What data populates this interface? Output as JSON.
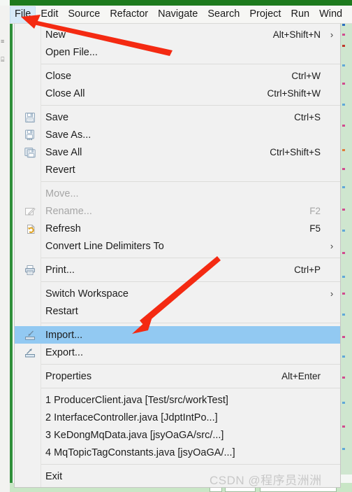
{
  "colors": {
    "accent_highlight": "#92c9f2",
    "menubar_active": "#d7e9f7",
    "menu_background": "#f1f1f1",
    "annotation_red": "#f42a12",
    "ide_green": "#2f8f3a",
    "watermark_gray": "#c8c8c8"
  },
  "menubar": {
    "items": [
      {
        "label": "File",
        "active": true
      },
      {
        "label": "Edit",
        "active": false
      },
      {
        "label": "Source",
        "active": false
      },
      {
        "label": "Refactor",
        "active": false
      },
      {
        "label": "Navigate",
        "active": false
      },
      {
        "label": "Search",
        "active": false
      },
      {
        "label": "Project",
        "active": false
      },
      {
        "label": "Run",
        "active": false
      },
      {
        "label": "Wind",
        "active": false
      }
    ]
  },
  "file_menu": {
    "groups": [
      {
        "items": [
          {
            "label": "New",
            "shortcut": "Alt+Shift+N",
            "submenu": true,
            "icon": "",
            "disabled": false,
            "highlight": false
          },
          {
            "label": "Open File...",
            "shortcut": "",
            "submenu": false,
            "icon": "",
            "disabled": false,
            "highlight": false
          }
        ]
      },
      {
        "items": [
          {
            "label": "Close",
            "shortcut": "Ctrl+W",
            "submenu": false,
            "icon": "",
            "disabled": false,
            "highlight": false
          },
          {
            "label": "Close All",
            "shortcut": "Ctrl+Shift+W",
            "submenu": false,
            "icon": "",
            "disabled": false,
            "highlight": false
          }
        ]
      },
      {
        "items": [
          {
            "label": "Save",
            "shortcut": "Ctrl+S",
            "submenu": false,
            "icon": "save-floppy-icon",
            "disabled": false,
            "highlight": false
          },
          {
            "label": "Save As...",
            "shortcut": "",
            "submenu": false,
            "icon": "save-as-floppy-icon",
            "disabled": false,
            "highlight": false
          },
          {
            "label": "Save All",
            "shortcut": "Ctrl+Shift+S",
            "submenu": false,
            "icon": "save-all-floppy-icon",
            "disabled": false,
            "highlight": false
          },
          {
            "label": "Revert",
            "shortcut": "",
            "submenu": false,
            "icon": "",
            "disabled": false,
            "highlight": false
          }
        ]
      },
      {
        "items": [
          {
            "label": "Move...",
            "shortcut": "",
            "submenu": false,
            "icon": "",
            "disabled": true,
            "highlight": false
          },
          {
            "label": "Rename...",
            "shortcut": "F2",
            "submenu": false,
            "icon": "rename-pencil-icon",
            "disabled": true,
            "highlight": false
          },
          {
            "label": "Refresh",
            "shortcut": "F5",
            "submenu": false,
            "icon": "refresh-document-icon",
            "disabled": false,
            "highlight": false
          },
          {
            "label": "Convert Line Delimiters To",
            "shortcut": "",
            "submenu": true,
            "icon": "",
            "disabled": false,
            "highlight": false
          }
        ]
      },
      {
        "items": [
          {
            "label": "Print...",
            "shortcut": "Ctrl+P",
            "submenu": false,
            "icon": "print-icon",
            "disabled": false,
            "highlight": false
          }
        ]
      },
      {
        "items": [
          {
            "label": "Switch Workspace",
            "shortcut": "",
            "submenu": true,
            "icon": "",
            "disabled": false,
            "highlight": false
          },
          {
            "label": "Restart",
            "shortcut": "",
            "submenu": false,
            "icon": "",
            "disabled": false,
            "highlight": false
          }
        ]
      },
      {
        "items": [
          {
            "label": "Import...",
            "shortcut": "",
            "submenu": false,
            "icon": "import-icon",
            "disabled": false,
            "highlight": true
          },
          {
            "label": "Export...",
            "shortcut": "",
            "submenu": false,
            "icon": "export-icon",
            "disabled": false,
            "highlight": false
          }
        ]
      },
      {
        "items": [
          {
            "label": "Properties",
            "shortcut": "Alt+Enter",
            "submenu": false,
            "icon": "",
            "disabled": false,
            "highlight": false
          }
        ]
      },
      {
        "items": [
          {
            "label": "1 ProducerClient.java  [Test/src/workTest]",
            "shortcut": "",
            "submenu": false,
            "icon": "",
            "disabled": false,
            "highlight": false
          },
          {
            "label": "2 InterfaceController.java  [JdptIntPo...]",
            "shortcut": "",
            "submenu": false,
            "icon": "",
            "disabled": false,
            "highlight": false
          },
          {
            "label": "3 KeDongMqData.java  [jsyOaGA/src/...]",
            "shortcut": "",
            "submenu": false,
            "icon": "",
            "disabled": false,
            "highlight": false
          },
          {
            "label": "4 MqTopicTagConstants.java  [jsyOaGA/...]",
            "shortcut": "",
            "submenu": false,
            "icon": "",
            "disabled": false,
            "highlight": false
          }
        ]
      },
      {
        "items": [
          {
            "label": "Exit",
            "shortcut": "",
            "submenu": false,
            "icon": "",
            "disabled": false,
            "highlight": false
          }
        ]
      }
    ]
  },
  "watermark": {
    "text": "CSDN @程序员洲洲"
  },
  "annotations": [
    {
      "name": "arrow-to-file-menu",
      "points_to": "File"
    },
    {
      "name": "arrow-to-import-item",
      "points_to": "Import..."
    }
  ]
}
